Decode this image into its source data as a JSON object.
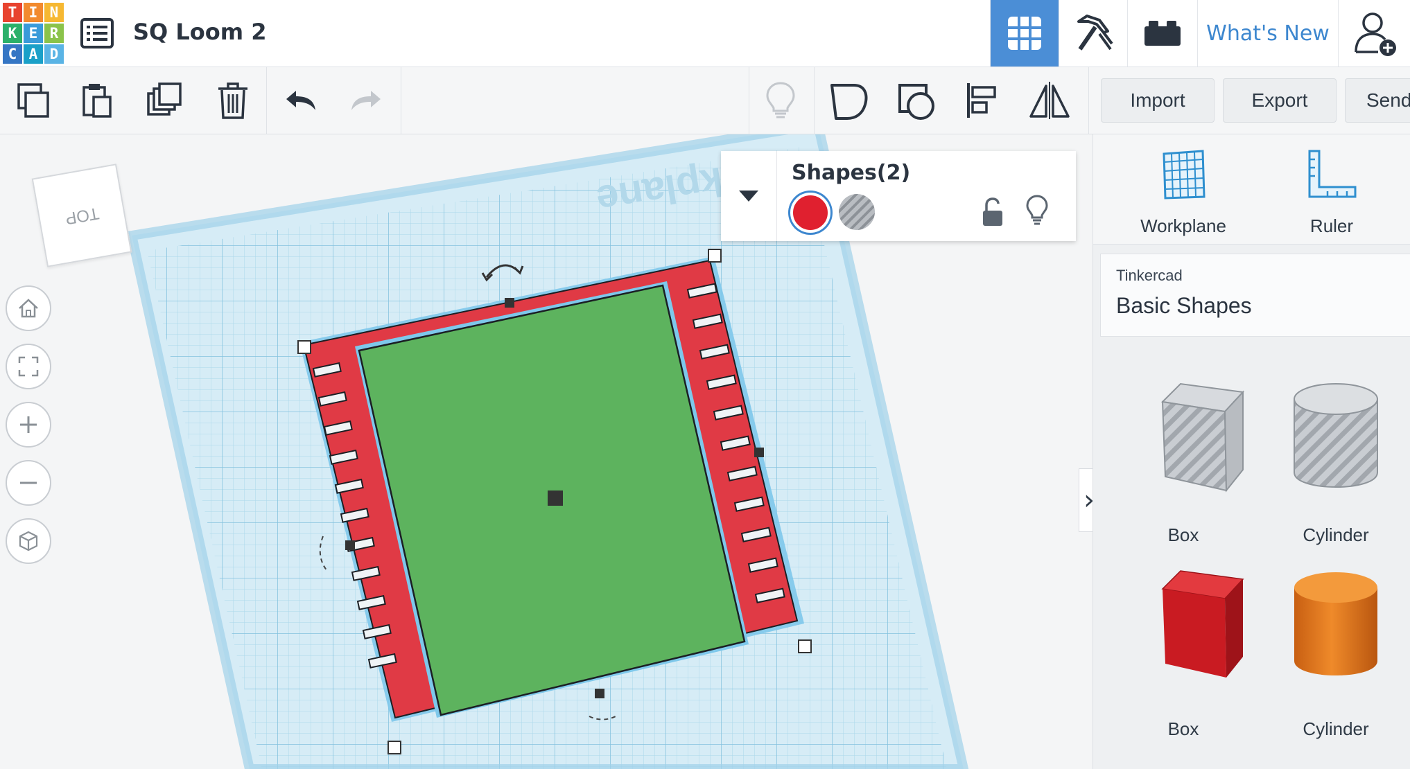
{
  "logo": {
    "letters": [
      "T",
      "I",
      "N",
      "K",
      "E",
      "R",
      "C",
      "A",
      "D"
    ],
    "colors": [
      "#e8432f",
      "#f28a2e",
      "#f6b832",
      "#2bb06a",
      "#3a9bd9",
      "#8bc34a",
      "#3576c4",
      "#1aa0c8",
      "#5ab4e5"
    ]
  },
  "header": {
    "title": "SQ Loom 2",
    "nav": [
      {
        "name": "3d-design",
        "icon": "grid-icon",
        "active": true
      },
      {
        "name": "codeblocks",
        "icon": "pickaxe-icon"
      },
      {
        "name": "lego-bricks",
        "icon": "brick-icon"
      },
      {
        "name": "whats-new",
        "label": "What's New"
      },
      {
        "name": "user",
        "icon": "add-user-icon"
      }
    ]
  },
  "toolbar": {
    "left_tools": [
      "copy-icon",
      "paste-icon",
      "duplicate-icon",
      "delete-icon",
      "undo-icon",
      "redo-icon"
    ],
    "right_tools": [
      "lightbulb-icon",
      "group-icon",
      "ungroup-icon",
      "align-icon",
      "mirror-icon"
    ],
    "import_label": "Import",
    "export_label": "Export",
    "send_label": "Send"
  },
  "viewport": {
    "viewcube_label": "TOP",
    "workplane_text": "Workplane",
    "nav_buttons": [
      "home-view-icon",
      "fit-view-icon",
      "zoom-in-icon",
      "zoom-out-icon",
      "perspective-icon"
    ]
  },
  "inspector": {
    "title": "Shapes(2)",
    "solid_color": "#e0202f"
  },
  "panel": {
    "workplane_label": "Workplane",
    "ruler_label": "Ruler",
    "library_source": "Tinkercad",
    "library_name": "Basic Shapes",
    "shapes": [
      {
        "label": "Box",
        "kind": "hole-box"
      },
      {
        "label": "Cylinder",
        "kind": "hole-cylinder"
      },
      {
        "label": "Box",
        "kind": "box",
        "color": "#d21f26"
      },
      {
        "label": "Cylinder",
        "kind": "cylinder",
        "color": "#e67a1e"
      }
    ]
  }
}
